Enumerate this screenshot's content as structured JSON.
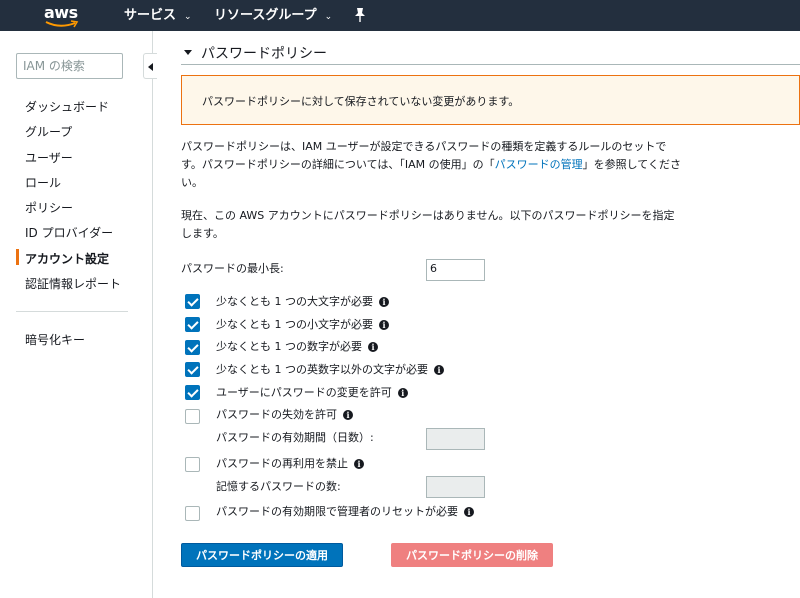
{
  "nav": {
    "logo": "aws",
    "services": "サービス",
    "resource_groups": "リソースグループ",
    "caret": "⌄"
  },
  "sidebar": {
    "search_placeholder": "IAM の検索",
    "items": [
      {
        "label": "ダッシュボード"
      },
      {
        "label": "グループ"
      },
      {
        "label": "ユーザー"
      },
      {
        "label": "ロール"
      },
      {
        "label": "ポリシー"
      },
      {
        "label": "ID プロバイダー"
      },
      {
        "label": "アカウント設定",
        "active": true
      },
      {
        "label": "認証情報レポート"
      }
    ],
    "encryption_keys": "暗号化キー"
  },
  "main": {
    "section_title": "パスワードポリシー",
    "warning": "パスワードポリシーに対して保存されていない変更があります。",
    "description": {
      "before_link": "パスワードポリシーは、IAM ユーザーが設定できるパスワードの種類を定義するルールのセットです。パスワードポリシーの詳細については、「IAM の使用」の「",
      "link": "パスワードの管理",
      "after_link": "」を参照してください。"
    },
    "no_policy_note": "現在、この AWS アカウントにパスワードポリシーはありません。以下のパスワードポリシーを指定します。",
    "min_length_label": "パスワードの最小長:",
    "min_length_value": "6",
    "options": [
      {
        "label": "少なくとも 1 つの大文字が必要",
        "checked": true
      },
      {
        "label": "少なくとも 1 つの小文字が必要",
        "checked": true
      },
      {
        "label": "少なくとも 1 つの数字が必要",
        "checked": true
      },
      {
        "label": "少なくとも 1 つの英数字以外の文字が必要",
        "checked": true
      },
      {
        "label": "ユーザーにパスワードの変更を許可",
        "checked": true
      },
      {
        "label": "パスワードの失効を許可",
        "checked": false
      },
      {
        "label": "パスワードの再利用を禁止",
        "checked": false
      },
      {
        "label": "パスワードの有効期限で管理者のリセットが必要",
        "checked": false
      }
    ],
    "expiry_period_label": "パスワードの有効期間（日数）:",
    "remember_count_label": "記憶するパスワードの数:",
    "info_glyph": "i",
    "apply_button": "パスワードポリシーの適用",
    "delete_button": "パスワードポリシーの削除"
  },
  "colors": {
    "nav_bg": "#232f3e",
    "accent": "#ec7211",
    "primary": "#0073bb",
    "danger_disabled": "#ef8080",
    "warning_bg": "#fef7ea"
  }
}
